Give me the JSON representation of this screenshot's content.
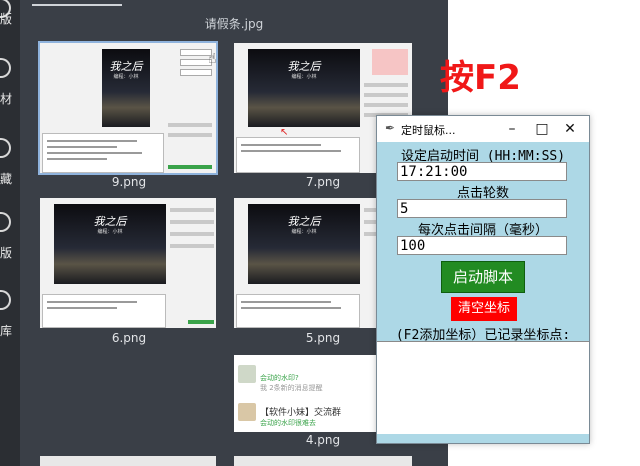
{
  "sidebar": {
    "items": [
      {
        "label": "版"
      },
      {
        "label": "材"
      },
      {
        "label": "藏"
      },
      {
        "label": "版"
      },
      {
        "label": "库"
      }
    ]
  },
  "gallery": {
    "title": "请假条.jpg",
    "thumbs": [
      {
        "label": "9.png"
      },
      {
        "label": "7.png"
      },
      {
        "label": "6.png"
      },
      {
        "label": "5.png"
      },
      {
        "label": "4.png"
      }
    ],
    "poster_title": "我之后",
    "poster_sub": "编程：小林"
  },
  "chat": {
    "line1": "会动的水印?",
    "line2": "我 2条新的消息提醒",
    "group": "【软件小妹】交流群",
    "line3": "会动的水印很难去"
  },
  "hint": "按F2",
  "window": {
    "title": "定时鼠标...",
    "label_start_time": "设定启动时间 (HH:MM:SS)",
    "start_time": "17:21:00",
    "label_rounds": "点击轮数",
    "rounds": "5",
    "label_interval": "每次点击间隔（毫秒）",
    "interval": "100",
    "start_button": "启动脚本",
    "clear_button": "清空坐标",
    "label_coords": "(F2添加坐标）已记录坐标点:"
  },
  "colors": {
    "window_bg": "#add8e6",
    "start_button": "#228b22",
    "clear_button": "#ff0000",
    "hint": "#f01818"
  }
}
